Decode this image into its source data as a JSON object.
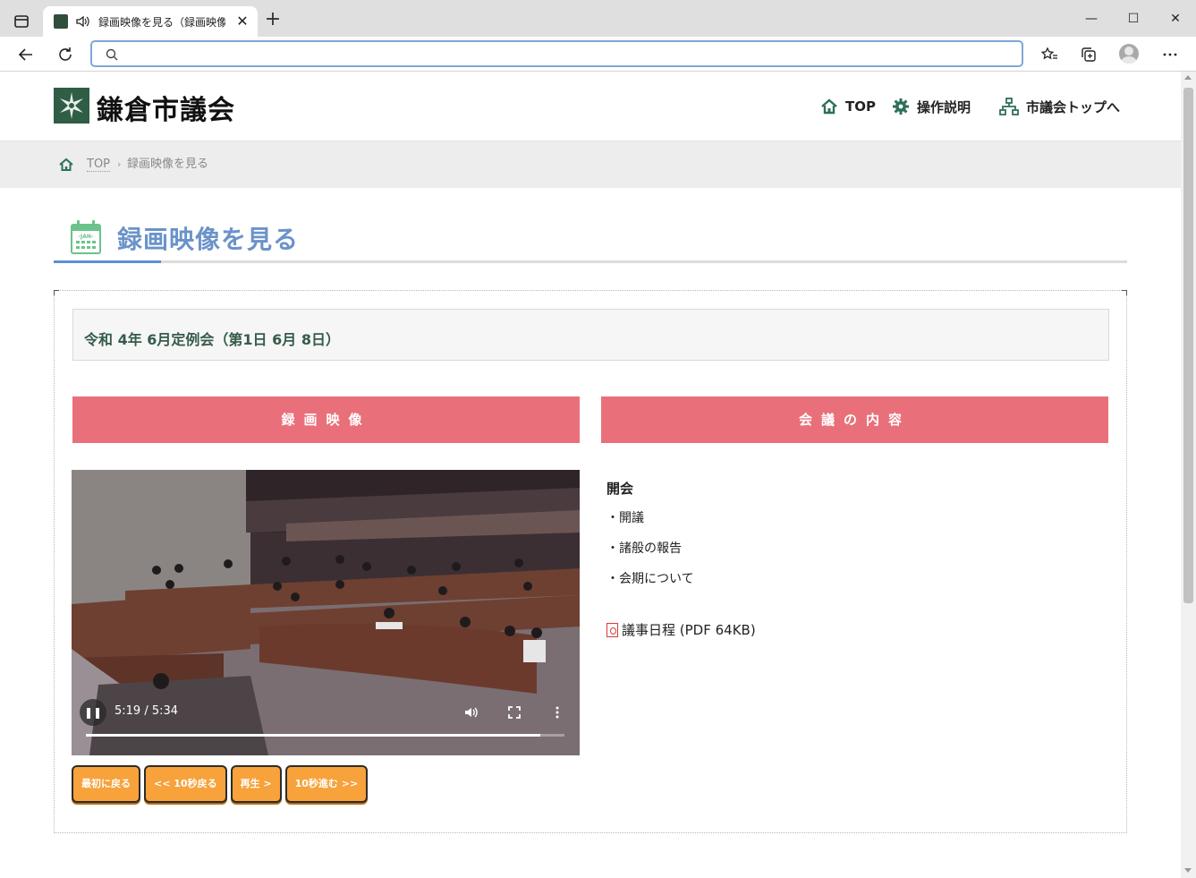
{
  "browser": {
    "tab_title": "録画映像を見る（録画映像）",
    "tab_close": "✕",
    "new_tab": "+",
    "address_value": "",
    "window": {
      "minimize": "—",
      "maximize": "☐",
      "close": "✕"
    }
  },
  "header": {
    "logo_text": "鎌倉市議会",
    "nav": [
      {
        "label": "TOP",
        "icon": "home-icon"
      },
      {
        "label": "操作説明",
        "icon": "gear-icon"
      },
      {
        "label": "市議会トップへ",
        "icon": "sitemap-icon"
      }
    ],
    "accent_color": "#2f6f5b"
  },
  "breadcrumb": {
    "home": "TOP",
    "separator": "›",
    "current": "録画映像を見る"
  },
  "page": {
    "title": "録画映像を見る",
    "title_color": "#6a93c9"
  },
  "session": {
    "title": "令和 4年 6月定例会（第1日 6月 8日）"
  },
  "panels": {
    "video_head": "録画映像",
    "content_head": "会議の内容",
    "head_color": "#e9707a"
  },
  "video": {
    "time": "5:19 / 5:34",
    "progress": 0.95,
    "play_state": "playing"
  },
  "video_buttons": [
    "最初に戻る",
    "<< 10秒戻る",
    "再生 >",
    "10秒進む >>"
  ],
  "minutes": {
    "heading": "開会",
    "items": [
      "・開議",
      "・諸般の報告",
      "・会期について"
    ],
    "pdf_label": "議事日程 (PDF 64KB)"
  }
}
